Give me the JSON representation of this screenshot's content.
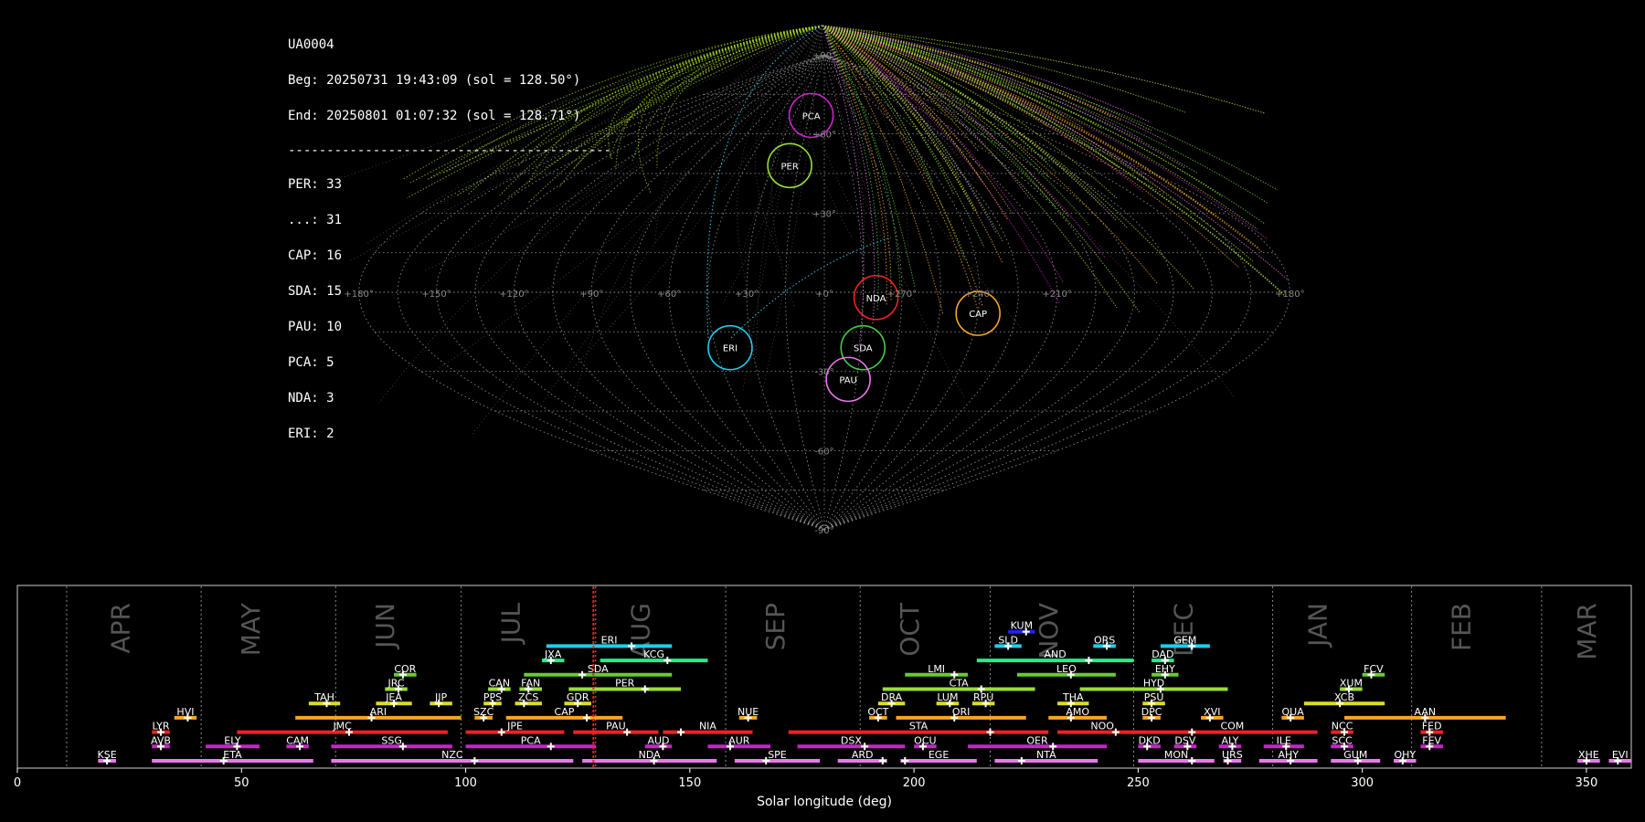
{
  "info": {
    "camera": "UA0004",
    "beg": "Beg: 20250731 19:43:09 (sol = 128.50°)",
    "end": "End: 20250801 01:07:32 (sol = 128.71°)",
    "sep": "------------------------------------------",
    "counts": [
      "PER: 33",
      "...: 31",
      "CAP: 16",
      "SDA: 15",
      "PAU: 10",
      "PCA: 5",
      "NDA: 3",
      "ERI: 2"
    ]
  },
  "sky_map": {
    "projection": "sinusoidal",
    "lon_labels": [
      "+180°",
      "+150°",
      "+120°",
      "+90°",
      "+60°",
      "+30°",
      "+0°",
      "+270°",
      "+240°",
      "+210°",
      "+180°"
    ],
    "lat_labels": [
      "+90°",
      "+60°",
      "+30°",
      "+0°",
      "-30°",
      "-60°",
      "-90°"
    ],
    "showers": [
      {
        "code": "PCA",
        "lon": -13,
        "lat": 67,
        "color": "#cc22cc"
      },
      {
        "code": "PER",
        "lon": -20,
        "lat": 48,
        "color": "#99dd33"
      },
      {
        "code": "NDA",
        "lon": 20,
        "lat": -2,
        "color": "#ee2222"
      },
      {
        "code": "CAP",
        "lon": 60,
        "lat": -8,
        "color": "#f5a623"
      },
      {
        "code": "ERI",
        "lon": -39,
        "lat": -21,
        "color": "#22ccee"
      },
      {
        "code": "SDA",
        "lon": 16,
        "lat": -21,
        "color": "#44cc44"
      },
      {
        "code": "PAU",
        "lon": 11,
        "lat": -33,
        "color": "#ee77ee"
      }
    ]
  },
  "chart_data": {
    "type": "timeline",
    "xlabel": "Solar longitude (deg)",
    "xlim": [
      0,
      360
    ],
    "xticks": [
      0,
      50,
      100,
      150,
      200,
      250,
      300,
      350
    ],
    "current_sol": 128.5,
    "months": [
      {
        "name": "APR",
        "sol": 25
      },
      {
        "name": "MAY",
        "sol": 54
      },
      {
        "name": "JUN",
        "sol": 84
      },
      {
        "name": "JUL",
        "sol": 112
      },
      {
        "name": "AUG",
        "sol": 141
      },
      {
        "name": "SEP",
        "sol": 171
      },
      {
        "name": "OCT",
        "sol": 201
      },
      {
        "name": "NOV",
        "sol": 232
      },
      {
        "name": "DEC",
        "sol": 262
      },
      {
        "name": "JAN",
        "sol": 292
      },
      {
        "name": "FEB",
        "sol": 324
      },
      {
        "name": "MAR",
        "sol": 352
      }
    ],
    "month_boundaries": [
      11,
      41,
      71,
      99,
      129,
      158,
      188,
      217,
      249,
      280,
      311,
      340
    ],
    "showers": [
      {
        "code": "KUM",
        "start": 221,
        "end": 227,
        "peak": 225,
        "row": 9,
        "color": "#2222ee"
      },
      {
        "code": "ERI",
        "start": 118,
        "end": 146,
        "peak": 137,
        "row": 8,
        "color": "#22ccee"
      },
      {
        "code": "SLD",
        "start": 218,
        "end": 224,
        "peak": 221,
        "row": 8,
        "color": "#22ccee"
      },
      {
        "code": "ORS",
        "start": 240,
        "end": 245,
        "peak": 243,
        "row": 8,
        "color": "#22ccee"
      },
      {
        "code": "GEM",
        "start": 255,
        "end": 266,
        "peak": 262,
        "row": 8,
        "color": "#22ccee"
      },
      {
        "code": "JXA",
        "start": 117,
        "end": 122,
        "peak": 119,
        "row": 7,
        "color": "#22ee88"
      },
      {
        "code": "KCG",
        "start": 130,
        "end": 154,
        "peak": 145,
        "row": 7,
        "color": "#22ee88"
      },
      {
        "code": "AND",
        "start": 214,
        "end": 249,
        "peak": 239,
        "row": 7,
        "color": "#22ee88"
      },
      {
        "code": "DAD",
        "start": 253,
        "end": 258,
        "peak": 256,
        "row": 7,
        "color": "#22ee88"
      },
      {
        "code": "COR",
        "start": 84,
        "end": 89,
        "peak": 86,
        "row": 6,
        "color": "#66cc33"
      },
      {
        "code": "SDA",
        "start": 113,
        "end": 146,
        "peak": 126,
        "row": 6,
        "color": "#66cc33"
      },
      {
        "code": "LMI",
        "start": 198,
        "end": 212,
        "peak": 209,
        "row": 6,
        "color": "#66cc33"
      },
      {
        "code": "LEO",
        "start": 223,
        "end": 245,
        "peak": 235,
        "row": 6,
        "color": "#66cc33"
      },
      {
        "code": "EHY",
        "start": 253,
        "end": 259,
        "peak": 256,
        "row": 6,
        "color": "#66cc33"
      },
      {
        "code": "FCV",
        "start": 300,
        "end": 305,
        "peak": 302,
        "row": 6,
        "color": "#66cc33"
      },
      {
        "code": "JRC",
        "start": 82,
        "end": 87,
        "peak": 85,
        "row": 5,
        "color": "#99dd33"
      },
      {
        "code": "CAN",
        "start": 105,
        "end": 110,
        "peak": 108,
        "row": 5,
        "color": "#99dd33"
      },
      {
        "code": "FAN",
        "start": 112,
        "end": 117,
        "peak": 114,
        "row": 5,
        "color": "#99dd33"
      },
      {
        "code": "PER",
        "start": 123,
        "end": 148,
        "peak": 140,
        "row": 5,
        "color": "#99dd33"
      },
      {
        "code": "CTA",
        "start": 193,
        "end": 227,
        "peak": 215,
        "row": 5,
        "color": "#99dd33"
      },
      {
        "code": "HYD",
        "start": 237,
        "end": 270,
        "peak": 255,
        "row": 5,
        "color": "#99dd33"
      },
      {
        "code": "XUM",
        "start": 295,
        "end": 300,
        "peak": 297,
        "row": 5,
        "color": "#99dd33"
      },
      {
        "code": "TAH",
        "start": 65,
        "end": 72,
        "peak": 69,
        "row": 4,
        "color": "#dddd22"
      },
      {
        "code": "JEA",
        "start": 80,
        "end": 88,
        "peak": 84,
        "row": 4,
        "color": "#dddd22"
      },
      {
        "code": "JIP",
        "start": 92,
        "end": 97,
        "peak": 94,
        "row": 4,
        "color": "#dddd22"
      },
      {
        "code": "PPS",
        "start": 104,
        "end": 108,
        "peak": 106,
        "row": 4,
        "color": "#dddd22"
      },
      {
        "code": "ZCS",
        "start": 111,
        "end": 117,
        "peak": 113,
        "row": 4,
        "color": "#dddd22"
      },
      {
        "code": "GDR",
        "start": 122,
        "end": 128,
        "peak": 125,
        "row": 4,
        "color": "#dddd22"
      },
      {
        "code": "DRA",
        "start": 192,
        "end": 198,
        "peak": 195,
        "row": 4,
        "color": "#dddd22"
      },
      {
        "code": "LUM",
        "start": 205,
        "end": 210,
        "peak": 208,
        "row": 4,
        "color": "#dddd22"
      },
      {
        "code": "RPU",
        "start": 213,
        "end": 218,
        "peak": 216,
        "row": 4,
        "color": "#dddd22"
      },
      {
        "code": "THA",
        "start": 232,
        "end": 239,
        "peak": 235,
        "row": 4,
        "color": "#dddd22"
      },
      {
        "code": "PSU",
        "start": 251,
        "end": 256,
        "peak": 253,
        "row": 4,
        "color": "#dddd22"
      },
      {
        "code": "XCB",
        "start": 287,
        "end": 305,
        "peak": 295,
        "row": 4,
        "color": "#dddd22"
      },
      {
        "code": "HVI",
        "start": 35,
        "end": 40,
        "peak": 38,
        "row": 3,
        "color": "#f5a623"
      },
      {
        "code": "ARI",
        "start": 62,
        "end": 99,
        "peak": 79,
        "row": 3,
        "color": "#f5a623"
      },
      {
        "code": "SZC",
        "start": 102,
        "end": 106,
        "peak": 104,
        "row": 3,
        "color": "#f5a623"
      },
      {
        "code": "CAP",
        "start": 109,
        "end": 135,
        "peak": 127,
        "row": 3,
        "color": "#f5a623"
      },
      {
        "code": "NUE",
        "start": 161,
        "end": 165,
        "peak": 163,
        "row": 3,
        "color": "#f5a623"
      },
      {
        "code": "OCT",
        "start": 190,
        "end": 194,
        "peak": 192,
        "row": 3,
        "color": "#f5a623"
      },
      {
        "code": "ORI",
        "start": 196,
        "end": 225,
        "peak": 209,
        "row": 3,
        "color": "#f5a623"
      },
      {
        "code": "AMO",
        "start": 230,
        "end": 243,
        "peak": 235,
        "row": 3,
        "color": "#f5a623"
      },
      {
        "code": "DPC",
        "start": 251,
        "end": 255,
        "peak": 253,
        "row": 3,
        "color": "#f5a623"
      },
      {
        "code": "XVI",
        "start": 264,
        "end": 269,
        "peak": 266,
        "row": 3,
        "color": "#f5a623"
      },
      {
        "code": "QUA",
        "start": 282,
        "end": 287,
        "peak": 284,
        "row": 3,
        "color": "#f5a623"
      },
      {
        "code": "AAN",
        "start": 296,
        "end": 332,
        "peak": 314,
        "row": 3,
        "color": "#f5a623"
      },
      {
        "code": "LYR",
        "start": 30,
        "end": 34,
        "peak": 32,
        "row": 2,
        "color": "#ee2222"
      },
      {
        "code": "JMC",
        "start": 49,
        "end": 96,
        "peak": 74,
        "row": 2,
        "color": "#ee2222"
      },
      {
        "code": "JPE",
        "start": 100,
        "end": 122,
        "peak": 108,
        "row": 2,
        "color": "#ee2222"
      },
      {
        "code": "PAU",
        "start": 124,
        "end": 143,
        "peak": 136,
        "row": 2,
        "color": "#ee2222"
      },
      {
        "code": "NIA",
        "start": 144,
        "end": 164,
        "peak": 148,
        "row": 2,
        "color": "#ee2222"
      },
      {
        "code": "STA",
        "start": 172,
        "end": 230,
        "peak": 217,
        "row": 2,
        "color": "#ee2222"
      },
      {
        "code": "NOO",
        "start": 232,
        "end": 252,
        "peak": 245,
        "row": 2,
        "color": "#ee2222"
      },
      {
        "code": "COM",
        "start": 252,
        "end": 290,
        "peak": 262,
        "row": 2,
        "color": "#ee2222"
      },
      {
        "code": "NCC",
        "start": 293,
        "end": 298,
        "peak": 296,
        "row": 2,
        "color": "#ee2222"
      },
      {
        "code": "FED",
        "start": 313,
        "end": 318,
        "peak": 315,
        "row": 2,
        "color": "#ee2222"
      },
      {
        "code": "AVB",
        "start": 30,
        "end": 34,
        "peak": 32,
        "row": 1,
        "color": "#cc22cc"
      },
      {
        "code": "ELY",
        "start": 42,
        "end": 54,
        "peak": 49,
        "row": 1,
        "color": "#cc22cc"
      },
      {
        "code": "CAM",
        "start": 60,
        "end": 65,
        "peak": 63,
        "row": 1,
        "color": "#cc22cc"
      },
      {
        "code": "SSG",
        "start": 70,
        "end": 97,
        "peak": 86,
        "row": 1,
        "color": "#cc22cc"
      },
      {
        "code": "PCA",
        "start": 100,
        "end": 129,
        "peak": 119,
        "row": 1,
        "color": "#cc22cc"
      },
      {
        "code": "AUD",
        "start": 140,
        "end": 146,
        "peak": 144,
        "row": 1,
        "color": "#cc22cc"
      },
      {
        "code": "AUR",
        "start": 154,
        "end": 168,
        "peak": 159,
        "row": 1,
        "color": "#cc22cc"
      },
      {
        "code": "DSX",
        "start": 174,
        "end": 198,
        "peak": 189,
        "row": 1,
        "color": "#cc22cc"
      },
      {
        "code": "OCU",
        "start": 200,
        "end": 205,
        "peak": 202,
        "row": 1,
        "color": "#cc22cc"
      },
      {
        "code": "OER",
        "start": 212,
        "end": 243,
        "peak": 231,
        "row": 1,
        "color": "#cc22cc"
      },
      {
        "code": "DKD",
        "start": 250,
        "end": 255,
        "peak": 252,
        "row": 1,
        "color": "#cc22cc"
      },
      {
        "code": "DSV",
        "start": 258,
        "end": 263,
        "peak": 261,
        "row": 1,
        "color": "#cc22cc"
      },
      {
        "code": "ALY",
        "start": 268,
        "end": 273,
        "peak": 271,
        "row": 1,
        "color": "#cc22cc"
      },
      {
        "code": "ILE",
        "start": 278,
        "end": 287,
        "peak": 283,
        "row": 1,
        "color": "#cc22cc"
      },
      {
        "code": "SCC",
        "start": 293,
        "end": 298,
        "peak": 296,
        "row": 1,
        "color": "#cc22cc"
      },
      {
        "code": "FEV",
        "start": 313,
        "end": 318,
        "peak": 315,
        "row": 1,
        "color": "#cc22cc"
      },
      {
        "code": "KSE",
        "start": 18,
        "end": 22,
        "peak": 20,
        "row": 0,
        "color": "#ee77ee"
      },
      {
        "code": "ETA",
        "start": 30,
        "end": 66,
        "peak": 46,
        "row": 0,
        "color": "#ee77ee"
      },
      {
        "code": "NZC",
        "start": 70,
        "end": 124,
        "peak": 102,
        "row": 0,
        "color": "#ee77ee"
      },
      {
        "code": "NDA",
        "start": 126,
        "end": 156,
        "peak": 142,
        "row": 0,
        "color": "#ee77ee"
      },
      {
        "code": "SPE",
        "start": 160,
        "end": 179,
        "peak": 167,
        "row": 0,
        "color": "#ee77ee"
      },
      {
        "code": "ARD",
        "start": 183,
        "end": 194,
        "peak": 193,
        "row": 0,
        "color": "#ee77ee"
      },
      {
        "code": "EGE",
        "start": 197,
        "end": 214,
        "peak": 198,
        "row": 0,
        "color": "#ee77ee"
      },
      {
        "code": "NTA",
        "start": 218,
        "end": 241,
        "peak": 224,
        "row": 0,
        "color": "#ee77ee"
      },
      {
        "code": "MON",
        "start": 250,
        "end": 267,
        "peak": 262,
        "row": 0,
        "color": "#ee77ee"
      },
      {
        "code": "URS",
        "start": 269,
        "end": 273,
        "peak": 270,
        "row": 0,
        "color": "#ee77ee"
      },
      {
        "code": "AHY",
        "start": 277,
        "end": 290,
        "peak": 284,
        "row": 0,
        "color": "#ee77ee"
      },
      {
        "code": "GUM",
        "start": 293,
        "end": 304,
        "peak": 299,
        "row": 0,
        "color": "#ee77ee"
      },
      {
        "code": "OHY",
        "start": 307,
        "end": 312,
        "peak": 309,
        "row": 0,
        "color": "#ee77ee"
      },
      {
        "code": "XHE",
        "start": 348,
        "end": 353,
        "peak": 350,
        "row": 0,
        "color": "#ee77ee"
      },
      {
        "code": "EVI",
        "start": 355,
        "end": 360,
        "peak": 357,
        "row": 0,
        "color": "#ee77ee"
      }
    ]
  }
}
